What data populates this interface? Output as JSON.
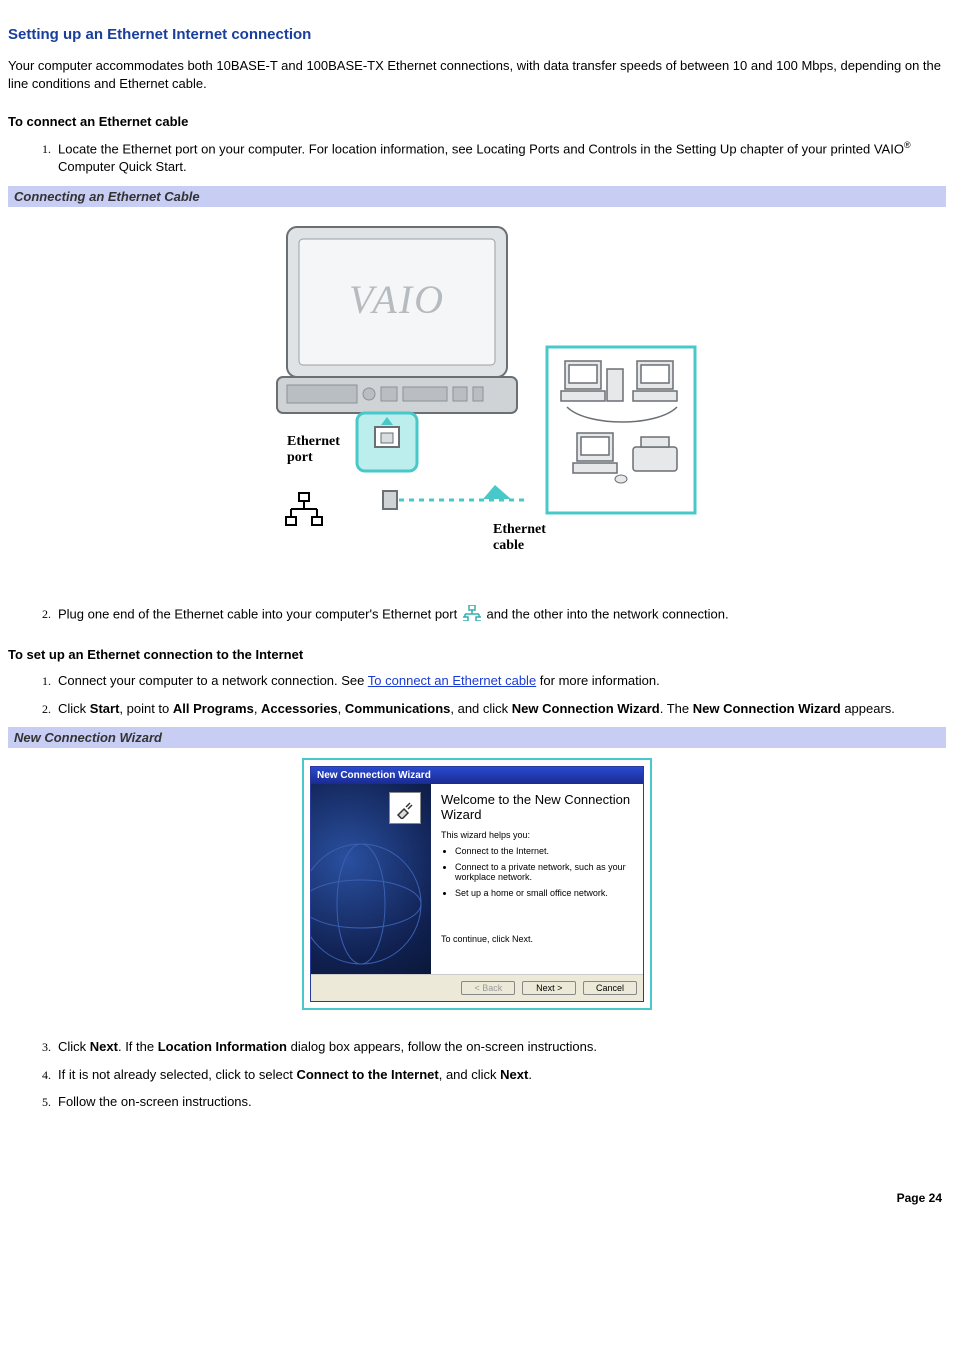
{
  "title": "Setting up an Ethernet Internet connection",
  "intro": "Your computer accommodates both 10BASE-T and 100BASE-TX Ethernet connections, with data transfer speeds of between 10 and 100 Mbps, depending on the line conditions and Ethernet cable.",
  "section1": {
    "heading": "To connect an Ethernet cable",
    "step1_a": "Locate the Ethernet port on your computer. For location information, see Locating Ports and Controls in the Setting Up chapter of your printed VAIO",
    "step1_b": " Computer Quick Start.",
    "band": "Connecting an Ethernet Cable",
    "labels": {
      "ethernet_port": "Ethernet port",
      "ethernet_cable": "Ethernet cable"
    },
    "step2_a": "Plug one end of the Ethernet cable into your computer's Ethernet port ",
    "step2_b": " and the other into the network connection."
  },
  "section2": {
    "heading": "To set up an Ethernet connection to the Internet",
    "step1_a": "Connect your computer to a network connection. See ",
    "step1_link": "To connect an Ethernet cable",
    "step1_b": " for more information.",
    "step2": {
      "pre": "Click ",
      "b1": "Start",
      "t1": ", point to ",
      "b2": "All Programs",
      "t2": ", ",
      "b3": "Accessories",
      "t3": ", ",
      "b4": "Communications",
      "t4": ", and click ",
      "b5": "New Connection Wizard",
      "t5": ". The ",
      "b6": "New Connection Wizard",
      "t6": " appears."
    },
    "band": "New Connection Wizard",
    "wizard": {
      "titlebar": "New Connection Wizard",
      "wtitle": "Welcome to the New Connection Wizard",
      "helps": "This wizard helps you:",
      "bul1": "Connect to the Internet.",
      "bul2": "Connect to a private network, such as your workplace network.",
      "bul3": "Set up a home or small office network.",
      "cont": "To continue, click Next.",
      "btn_back": "< Back",
      "btn_next": "Next >",
      "btn_cancel": "Cancel"
    },
    "step3": {
      "pre": "Click ",
      "b1": "Next",
      "t1": ". If the ",
      "b2": "Location Information",
      "t2": " dialog box appears, follow the on-screen instructions."
    },
    "step4": {
      "pre": "If it is not already selected, click to select ",
      "b1": "Connect to the Internet",
      "t1": ", and click ",
      "b2": "Next",
      "t2": "."
    },
    "step5": "Follow the on-screen instructions."
  },
  "page_label": "Page 24",
  "reg": "®"
}
